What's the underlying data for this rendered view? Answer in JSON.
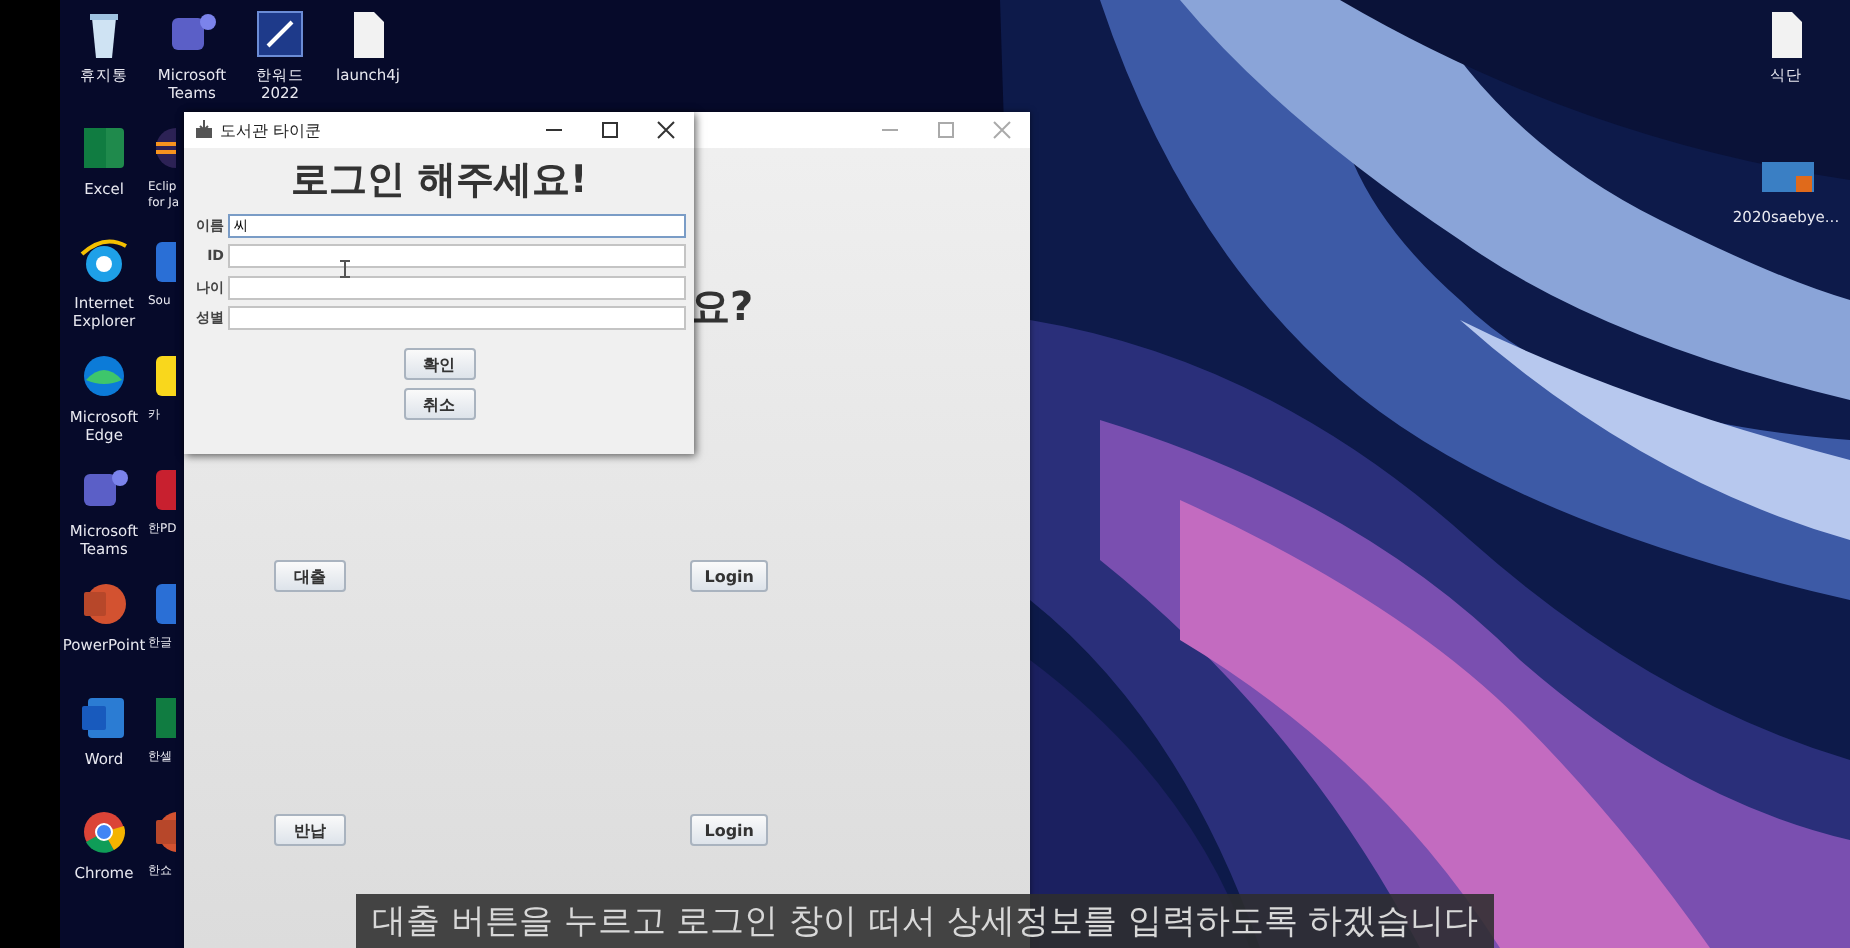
{
  "icon_columns": [
    [
      {
        "label": "휴지통",
        "kind": "recycle"
      },
      {
        "label": "Excel",
        "kind": "excel"
      },
      {
        "label": "Internet Explorer",
        "kind": "ie"
      },
      {
        "label": "Microsoft Edge",
        "kind": "edge"
      },
      {
        "label": "Microsoft Teams",
        "kind": "teams"
      },
      {
        "label": "PowerPoint",
        "kind": "powerpoint"
      },
      {
        "label": "Word",
        "kind": "word"
      },
      {
        "label": "Chrome",
        "kind": "chrome"
      }
    ],
    [
      {
        "label": "Microsoft Teams",
        "kind": "teams"
      },
      {
        "label": "Eclip for Ja",
        "kind": "eclipse"
      },
      {
        "label": "Sou",
        "kind": "blue"
      },
      {
        "label": "카",
        "kind": "yellow"
      },
      {
        "label": "한PD",
        "kind": "red"
      },
      {
        "label": "한글",
        "kind": "blue"
      },
      {
        "label": "한셀",
        "kind": "excel"
      },
      {
        "label": "한쇼",
        "kind": "powerpoint"
      }
    ],
    [
      {
        "label": "한워드 2022",
        "kind": "hwp"
      }
    ],
    [
      {
        "label": "launch4j",
        "kind": "file"
      }
    ]
  ],
  "right_icons": [
    {
      "label": "식단",
      "kind": "file"
    },
    {
      "label": "2020saebye...",
      "kind": "slide"
    }
  ],
  "main_window": {
    "heading": "요?",
    "button_rows": [
      [
        "대출",
        "Login"
      ],
      [
        "반납",
        "Login"
      ]
    ]
  },
  "dialog": {
    "title": "도서관 타이쿤",
    "heading": "로그인 해주세요!",
    "fields": [
      {
        "label": "이름",
        "value": "씨",
        "focused": true
      },
      {
        "label": "ID",
        "focused": false
      },
      {
        "label": "나이",
        "focused": false
      },
      {
        "label": "성별",
        "focused": false
      }
    ],
    "buttons": [
      "확인",
      "취소"
    ]
  },
  "subtitle": "대출 버튼을 누르고 로그인 창이 떠서 상세정보를 입력하도록 하겠습니다"
}
